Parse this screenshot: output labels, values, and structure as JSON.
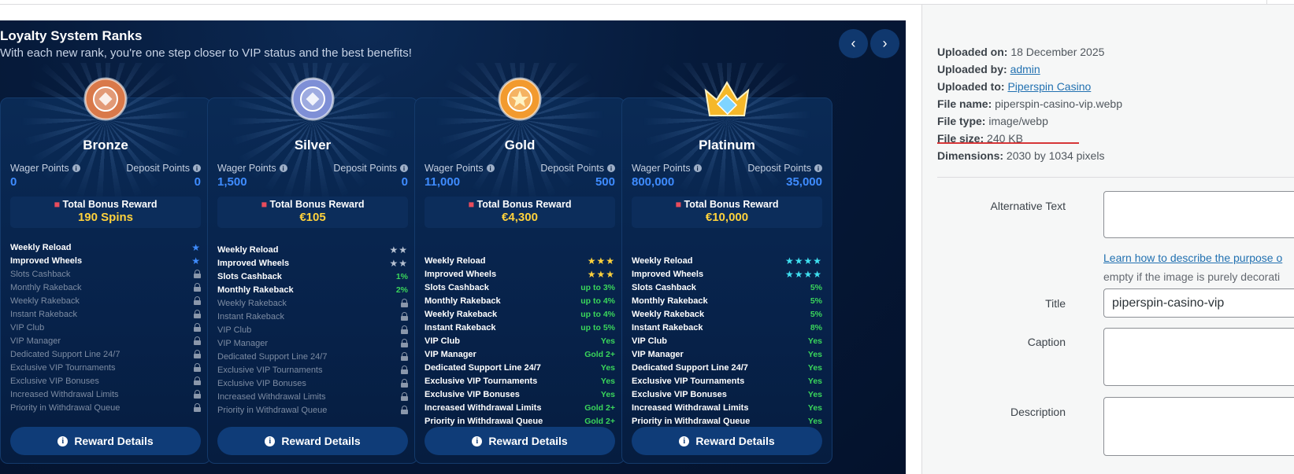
{
  "image": {
    "title": "Loyalty System Ranks",
    "subtitle": "With each new rank, you're one step closer to VIP status and the best benefits!",
    "nav": {
      "prev": "‹",
      "next": "›"
    },
    "wager_label": "Wager Points",
    "deposit_label": "Deposit Points",
    "bonus_label": "Total Bonus Reward",
    "reward_button": "Reward Details",
    "ranks": [
      {
        "name": "Bronze",
        "wager": "0",
        "deposit": "0",
        "bonus": "190 Spins",
        "badge_color": "#d9794a",
        "benefits": [
          {
            "name": "Weekly Reload",
            "value": "★",
            "type": "star"
          },
          {
            "name": "Improved Wheels",
            "value": "★",
            "type": "star"
          },
          {
            "name": "Slots Cashback",
            "type": "lock"
          },
          {
            "name": "Monthly Rakeback",
            "type": "lock"
          },
          {
            "name": "Weekly Rakeback",
            "type": "lock"
          },
          {
            "name": "Instant Rakeback",
            "type": "lock"
          },
          {
            "name": "VIP Club",
            "type": "lock"
          },
          {
            "name": "VIP Manager",
            "type": "lock"
          },
          {
            "name": "Dedicated Support Line 24/7",
            "type": "lock"
          },
          {
            "name": "Exclusive VIP Tournaments",
            "type": "lock"
          },
          {
            "name": "Exclusive VIP Bonuses",
            "type": "lock"
          },
          {
            "name": "Increased Withdrawal Limits",
            "type": "lock"
          },
          {
            "name": "Priority in Withdrawal Queue",
            "type": "lock"
          }
        ]
      },
      {
        "name": "Silver",
        "wager": "1,500",
        "deposit": "0",
        "bonus": "€105",
        "badge_color": "#7e8fd6",
        "benefits": [
          {
            "name": "Weekly Reload",
            "value": "★★",
            "type": "star"
          },
          {
            "name": "Improved Wheels",
            "value": "★★",
            "type": "star"
          },
          {
            "name": "Slots Cashback",
            "value": "1%",
            "type": "value"
          },
          {
            "name": "Monthly Rakeback",
            "value": "2%",
            "type": "value"
          },
          {
            "name": "Weekly Rakeback",
            "type": "lock"
          },
          {
            "name": "Instant Rakeback",
            "type": "lock"
          },
          {
            "name": "VIP Club",
            "type": "lock"
          },
          {
            "name": "VIP Manager",
            "type": "lock"
          },
          {
            "name": "Dedicated Support Line 24/7",
            "type": "lock"
          },
          {
            "name": "Exclusive VIP Tournaments",
            "type": "lock"
          },
          {
            "name": "Exclusive VIP Bonuses",
            "type": "lock"
          },
          {
            "name": "Increased Withdrawal Limits",
            "type": "lock"
          },
          {
            "name": "Priority in Withdrawal Queue",
            "type": "lock"
          }
        ]
      },
      {
        "name": "Gold",
        "wager": "11,000",
        "deposit": "500",
        "bonus": "€4,300",
        "badge_color": "#f29a2e",
        "benefits": [
          {
            "name": "Weekly Reload",
            "value": "★★★",
            "type": "star"
          },
          {
            "name": "Improved Wheels",
            "value": "★★★",
            "type": "star"
          },
          {
            "name": "Slots Cashback",
            "value": "up to 3%",
            "type": "value"
          },
          {
            "name": "Monthly Rakeback",
            "value": "up to 4%",
            "type": "value"
          },
          {
            "name": "Weekly Rakeback",
            "value": "up to 4%",
            "type": "value"
          },
          {
            "name": "Instant Rakeback",
            "value": "up to 5%",
            "type": "value"
          },
          {
            "name": "VIP Club",
            "value": "Yes",
            "type": "value"
          },
          {
            "name": "VIP Manager",
            "value": "Gold 2+",
            "type": "value"
          },
          {
            "name": "Dedicated Support Line 24/7",
            "value": "Yes",
            "type": "value"
          },
          {
            "name": "Exclusive VIP Tournaments",
            "value": "Yes",
            "type": "value"
          },
          {
            "name": "Exclusive VIP Bonuses",
            "value": "Yes",
            "type": "value"
          },
          {
            "name": "Increased Withdrawal Limits",
            "value": "Gold 2+",
            "type": "value"
          },
          {
            "name": "Priority in Withdrawal Queue",
            "value": "Gold 2+",
            "type": "value"
          }
        ]
      },
      {
        "name": "Platinum",
        "wager": "800,000",
        "deposit": "35,000",
        "bonus": "€10,000",
        "badge_color": "#f5b82a",
        "benefits": [
          {
            "name": "Weekly Reload",
            "value": "★★★★",
            "type": "star"
          },
          {
            "name": "Improved Wheels",
            "value": "★★★★",
            "type": "star"
          },
          {
            "name": "Slots Cashback",
            "value": "5%",
            "type": "value"
          },
          {
            "name": "Monthly Rakeback",
            "value": "5%",
            "type": "value"
          },
          {
            "name": "Weekly Rakeback",
            "value": "5%",
            "type": "value"
          },
          {
            "name": "Instant Rakeback",
            "value": "8%",
            "type": "value"
          },
          {
            "name": "VIP Club",
            "value": "Yes",
            "type": "value"
          },
          {
            "name": "VIP Manager",
            "value": "Yes",
            "type": "value"
          },
          {
            "name": "Dedicated Support Line 24/7",
            "value": "Yes",
            "type": "value"
          },
          {
            "name": "Exclusive VIP Tournaments",
            "value": "Yes",
            "type": "value"
          },
          {
            "name": "Exclusive VIP Bonuses",
            "value": "Yes",
            "type": "value"
          },
          {
            "name": "Increased Withdrawal Limits",
            "value": "Yes",
            "type": "value"
          },
          {
            "name": "Priority in Withdrawal Queue",
            "value": "Yes",
            "type": "value"
          }
        ]
      }
    ],
    "star_colors": [
      "#3f8cff",
      "#b7c1d1",
      "#ffd23c",
      "#3fe0f0"
    ]
  },
  "attachment": {
    "uploaded_on_label": "Uploaded on:",
    "uploaded_on": "18 December 2025",
    "uploaded_by_label": "Uploaded by:",
    "uploaded_by": "admin",
    "uploaded_to_label": "Uploaded to:",
    "uploaded_to": "Piperspin Casino",
    "file_name_label": "File name:",
    "file_name": "piperspin-casino-vip.webp",
    "file_type_label": "File type:",
    "file_type": "image/webp",
    "file_size_label": "File size:",
    "file_size": "240 KB",
    "dimensions_label": "Dimensions:",
    "dimensions": "2030 by 1034 pixels"
  },
  "form": {
    "alt_label": "Alternative Text",
    "alt_value": "",
    "alt_help_link": "Learn how to describe the purpose o",
    "alt_help_text": "empty if the image is purely decorati",
    "title_label": "Title",
    "title_value": "piperspin-casino-vip",
    "caption_label": "Caption",
    "caption_value": "",
    "description_label": "Description",
    "description_value": ""
  }
}
